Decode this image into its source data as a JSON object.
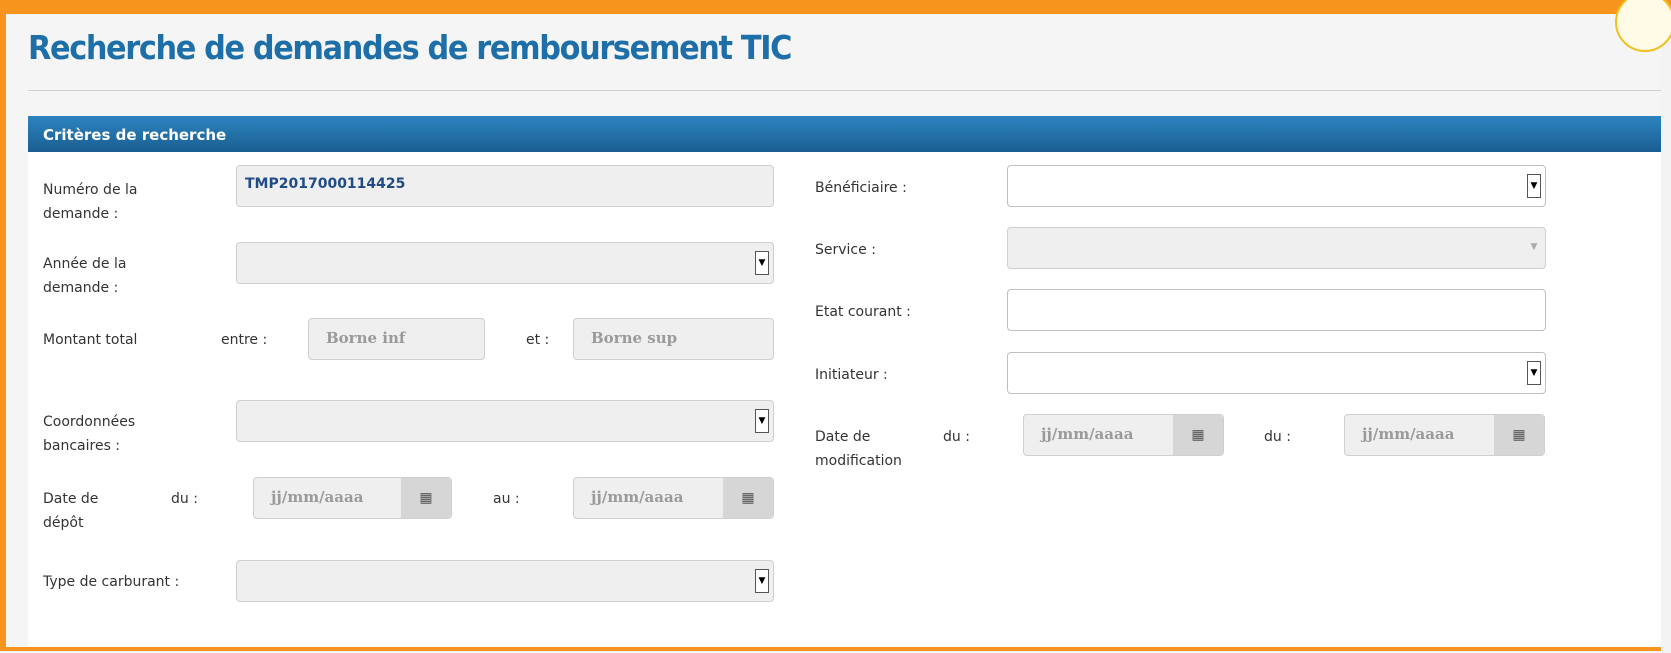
{
  "page": {
    "title": "Recherche de demandes de remboursement TIC",
    "panel_title": "Critères de recherche"
  },
  "left": {
    "numero": {
      "label_1": "Numéro de la",
      "label_2": "demande :",
      "value": "TMP2017000114425"
    },
    "annee": {
      "label_1": "Année de la",
      "label_2": "demande :",
      "value": ""
    },
    "montant": {
      "label": "Montant total",
      "entre": "entre :",
      "et": "et :",
      "inf_placeholder": "Borne inf",
      "sup_placeholder": "Borne sup"
    },
    "coordonnees": {
      "label_1": "Coordonnées",
      "label_2": "bancaires :",
      "value": ""
    },
    "date_depot": {
      "label_1": "Date de",
      "label_2": "dépôt",
      "du": "du :",
      "au": "au :",
      "from_placeholder": "jj/mm/aaaa",
      "to_placeholder": "jj/mm/aaaa"
    },
    "carburant": {
      "label": "Type de carburant :",
      "value": ""
    }
  },
  "right": {
    "beneficiaire": {
      "label": "Bénéficiaire :",
      "value": ""
    },
    "service": {
      "label": "Service :",
      "value": ""
    },
    "etat": {
      "label": "Etat courant :",
      "value": ""
    },
    "initiateur": {
      "label": "Initiateur :",
      "value": ""
    },
    "date_modif": {
      "label_1": "Date de",
      "label_2": "modification",
      "du1": "du :",
      "du2": "du :",
      "from_placeholder": "jj/mm/aaaa",
      "to_placeholder": "jj/mm/aaaa"
    }
  },
  "icons": {
    "dropdown": "chevron-down-icon",
    "calendar": "calendar-grid-icon"
  },
  "colors": {
    "accent": "#f7941d",
    "title": "#1e6fa8",
    "header": "#1a5e91",
    "value": "#1f4b86"
  }
}
